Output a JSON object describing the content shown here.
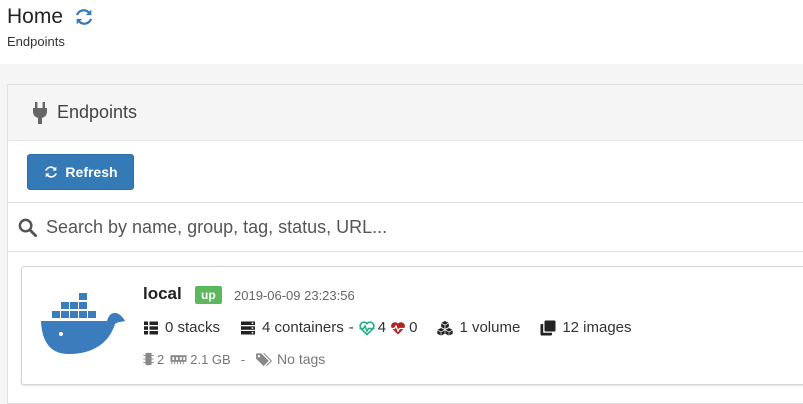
{
  "header": {
    "title": "Home",
    "breadcrumb": "Endpoints"
  },
  "panel": {
    "title": "Endpoints",
    "refresh_label": "Refresh",
    "search_placeholder": "Search by name, group, tag, status, URL..."
  },
  "endpoint": {
    "name": "local",
    "status": "up",
    "timestamp": "2019-06-09 23:23:56",
    "stacks": "0 stacks",
    "containers": "4 containers",
    "dash": "-",
    "healthy": "4",
    "unhealthy": "0",
    "volumes": "1 volume",
    "images": "12 images",
    "cpu": "2",
    "memory": "2.1 GB",
    "meta_sep": "-",
    "tags": "No tags"
  },
  "colors": {
    "primary": "#337ab7",
    "status_up": "#5cb85c",
    "healthy": "#23ae89",
    "unhealthy": "#ae2323",
    "docker_blue": "#3a7cbc"
  }
}
